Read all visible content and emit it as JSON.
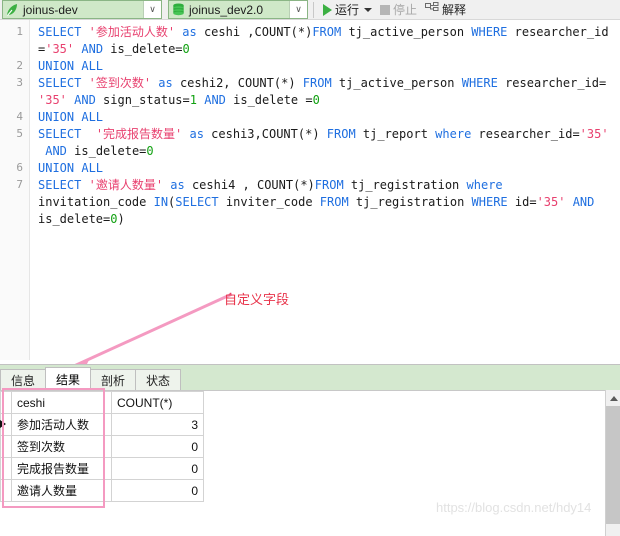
{
  "toolbar": {
    "connection": {
      "label": "joinus-dev",
      "icon": "leaf-icon",
      "arrow": "∨"
    },
    "database": {
      "label": "joinus_dev2.0",
      "icon": "database-stack-icon",
      "arrow": "∨"
    },
    "run": {
      "label": "运行",
      "icon": "play-triangle-icon"
    },
    "stop": {
      "label": "停止",
      "icon": "stop-square-icon",
      "enabled": false
    },
    "explain": {
      "label": "解释",
      "icon": "explain-icon"
    }
  },
  "editor": {
    "line_numbers": [
      "1",
      "2",
      "3",
      "4",
      "5",
      "6",
      "7"
    ],
    "lines": [
      {
        "n": "1",
        "tokens": [
          {
            "t": "kw",
            "v": "SELECT"
          },
          {
            "t": "pln",
            "v": " "
          },
          {
            "t": "str",
            "v": "'参加活动人数'"
          },
          {
            "t": "pln",
            "v": " "
          },
          {
            "t": "kw",
            "v": "as"
          },
          {
            "t": "pln",
            "v": " ceshi ,"
          },
          {
            "t": "pln",
            "v": "COUNT(*)"
          },
          {
            "t": "kw",
            "v": "FROM"
          },
          {
            "t": "pln",
            "v": " tj_active_person "
          },
          {
            "t": "kw",
            "v": "WHERE"
          },
          {
            "t": "pln",
            "v": " researcher_id\n="
          },
          {
            "t": "str",
            "v": "'35'"
          },
          {
            "t": "pln",
            "v": " "
          },
          {
            "t": "kw",
            "v": "AND"
          },
          {
            "t": "pln",
            "v": " is_delete="
          },
          {
            "t": "num",
            "v": "0"
          }
        ]
      },
      {
        "n": "2",
        "tokens": [
          {
            "t": "kw",
            "v": "UNION ALL"
          }
        ]
      },
      {
        "n": "3",
        "tokens": [
          {
            "t": "kw",
            "v": "SELECT"
          },
          {
            "t": "pln",
            "v": " "
          },
          {
            "t": "str",
            "v": "'签到次数'"
          },
          {
            "t": "pln",
            "v": " "
          },
          {
            "t": "kw",
            "v": "as"
          },
          {
            "t": "pln",
            "v": " ceshi2, COUNT(*) "
          },
          {
            "t": "kw",
            "v": "FROM"
          },
          {
            "t": "pln",
            "v": " tj_active_person "
          },
          {
            "t": "kw",
            "v": "WHERE"
          },
          {
            "t": "pln",
            "v": " researcher_id=\n"
          },
          {
            "t": "str",
            "v": "'35'"
          },
          {
            "t": "pln",
            "v": " "
          },
          {
            "t": "kw",
            "v": "AND"
          },
          {
            "t": "pln",
            "v": " sign_status="
          },
          {
            "t": "num",
            "v": "1"
          },
          {
            "t": "pln",
            "v": " "
          },
          {
            "t": "kw",
            "v": "AND"
          },
          {
            "t": "pln",
            "v": " is_delete ="
          },
          {
            "t": "num",
            "v": "0"
          }
        ]
      },
      {
        "n": "4",
        "tokens": [
          {
            "t": "kw",
            "v": "UNION ALL"
          }
        ]
      },
      {
        "n": "5",
        "tokens": [
          {
            "t": "kw",
            "v": "SELECT"
          },
          {
            "t": "pln",
            "v": "  "
          },
          {
            "t": "str",
            "v": "'完成报告数量'"
          },
          {
            "t": "pln",
            "v": " "
          },
          {
            "t": "kw",
            "v": "as"
          },
          {
            "t": "pln",
            "v": " ceshi3,COUNT(*) "
          },
          {
            "t": "kw",
            "v": "FROM"
          },
          {
            "t": "pln",
            "v": " tj_report "
          },
          {
            "t": "kw",
            "v": "where"
          },
          {
            "t": "pln",
            "v": " researcher_id="
          },
          {
            "t": "str",
            "v": "'35'"
          },
          {
            "t": "pln",
            "v": "\n "
          },
          {
            "t": "kw",
            "v": "AND"
          },
          {
            "t": "pln",
            "v": " is_delete="
          },
          {
            "t": "num",
            "v": "0"
          }
        ]
      },
      {
        "n": "6",
        "tokens": [
          {
            "t": "kw",
            "v": "UNION ALL"
          }
        ]
      },
      {
        "n": "7",
        "tokens": [
          {
            "t": "kw",
            "v": "SELECT"
          },
          {
            "t": "pln",
            "v": " "
          },
          {
            "t": "str",
            "v": "'邀请人数量'"
          },
          {
            "t": "pln",
            "v": " "
          },
          {
            "t": "kw",
            "v": "as"
          },
          {
            "t": "pln",
            "v": " ceshi4 , COUNT(*)"
          },
          {
            "t": "kw",
            "v": "FROM"
          },
          {
            "t": "pln",
            "v": " tj_registration "
          },
          {
            "t": "kw",
            "v": "where"
          },
          {
            "t": "pln",
            "v": "\ninvitation_code "
          },
          {
            "t": "kw",
            "v": "IN"
          },
          {
            "t": "pln",
            "v": "("
          },
          {
            "t": "kw",
            "v": "SELECT"
          },
          {
            "t": "pln",
            "v": " inviter_code "
          },
          {
            "t": "kw",
            "v": "FROM"
          },
          {
            "t": "pln",
            "v": " tj_registration "
          },
          {
            "t": "kw",
            "v": "WHERE"
          },
          {
            "t": "pln",
            "v": " id="
          },
          {
            "t": "str",
            "v": "'35'"
          },
          {
            "t": "pln",
            "v": " "
          },
          {
            "t": "kw",
            "v": "AND"
          },
          {
            "t": "pln",
            "v": "\nis_delete="
          },
          {
            "t": "num",
            "v": "0"
          },
          {
            "t": "pln",
            "v": ")"
          }
        ]
      }
    ]
  },
  "annotation": {
    "text": "自定义字段",
    "color": "#e8334a",
    "arrow_color": "#f49ac1"
  },
  "result_tabs": [
    {
      "label": "信息",
      "active": false
    },
    {
      "label": "结果",
      "active": true
    },
    {
      "label": "剖析",
      "active": false
    },
    {
      "label": "状态",
      "active": false
    }
  ],
  "result_grid": {
    "columns": [
      "ceshi",
      "COUNT(*)"
    ],
    "selected_column": "ceshi",
    "rows": [
      {
        "ceshi": "参加活动人数",
        "count": "3",
        "current": true
      },
      {
        "ceshi": "签到次数",
        "count": "0",
        "current": false
      },
      {
        "ceshi": "完成报告数量",
        "count": "0",
        "current": false
      },
      {
        "ceshi": "邀请人数量",
        "count": "0",
        "current": false
      }
    ]
  },
  "watermark": {
    "text": "https://blog.csdn.net/hdy14"
  }
}
